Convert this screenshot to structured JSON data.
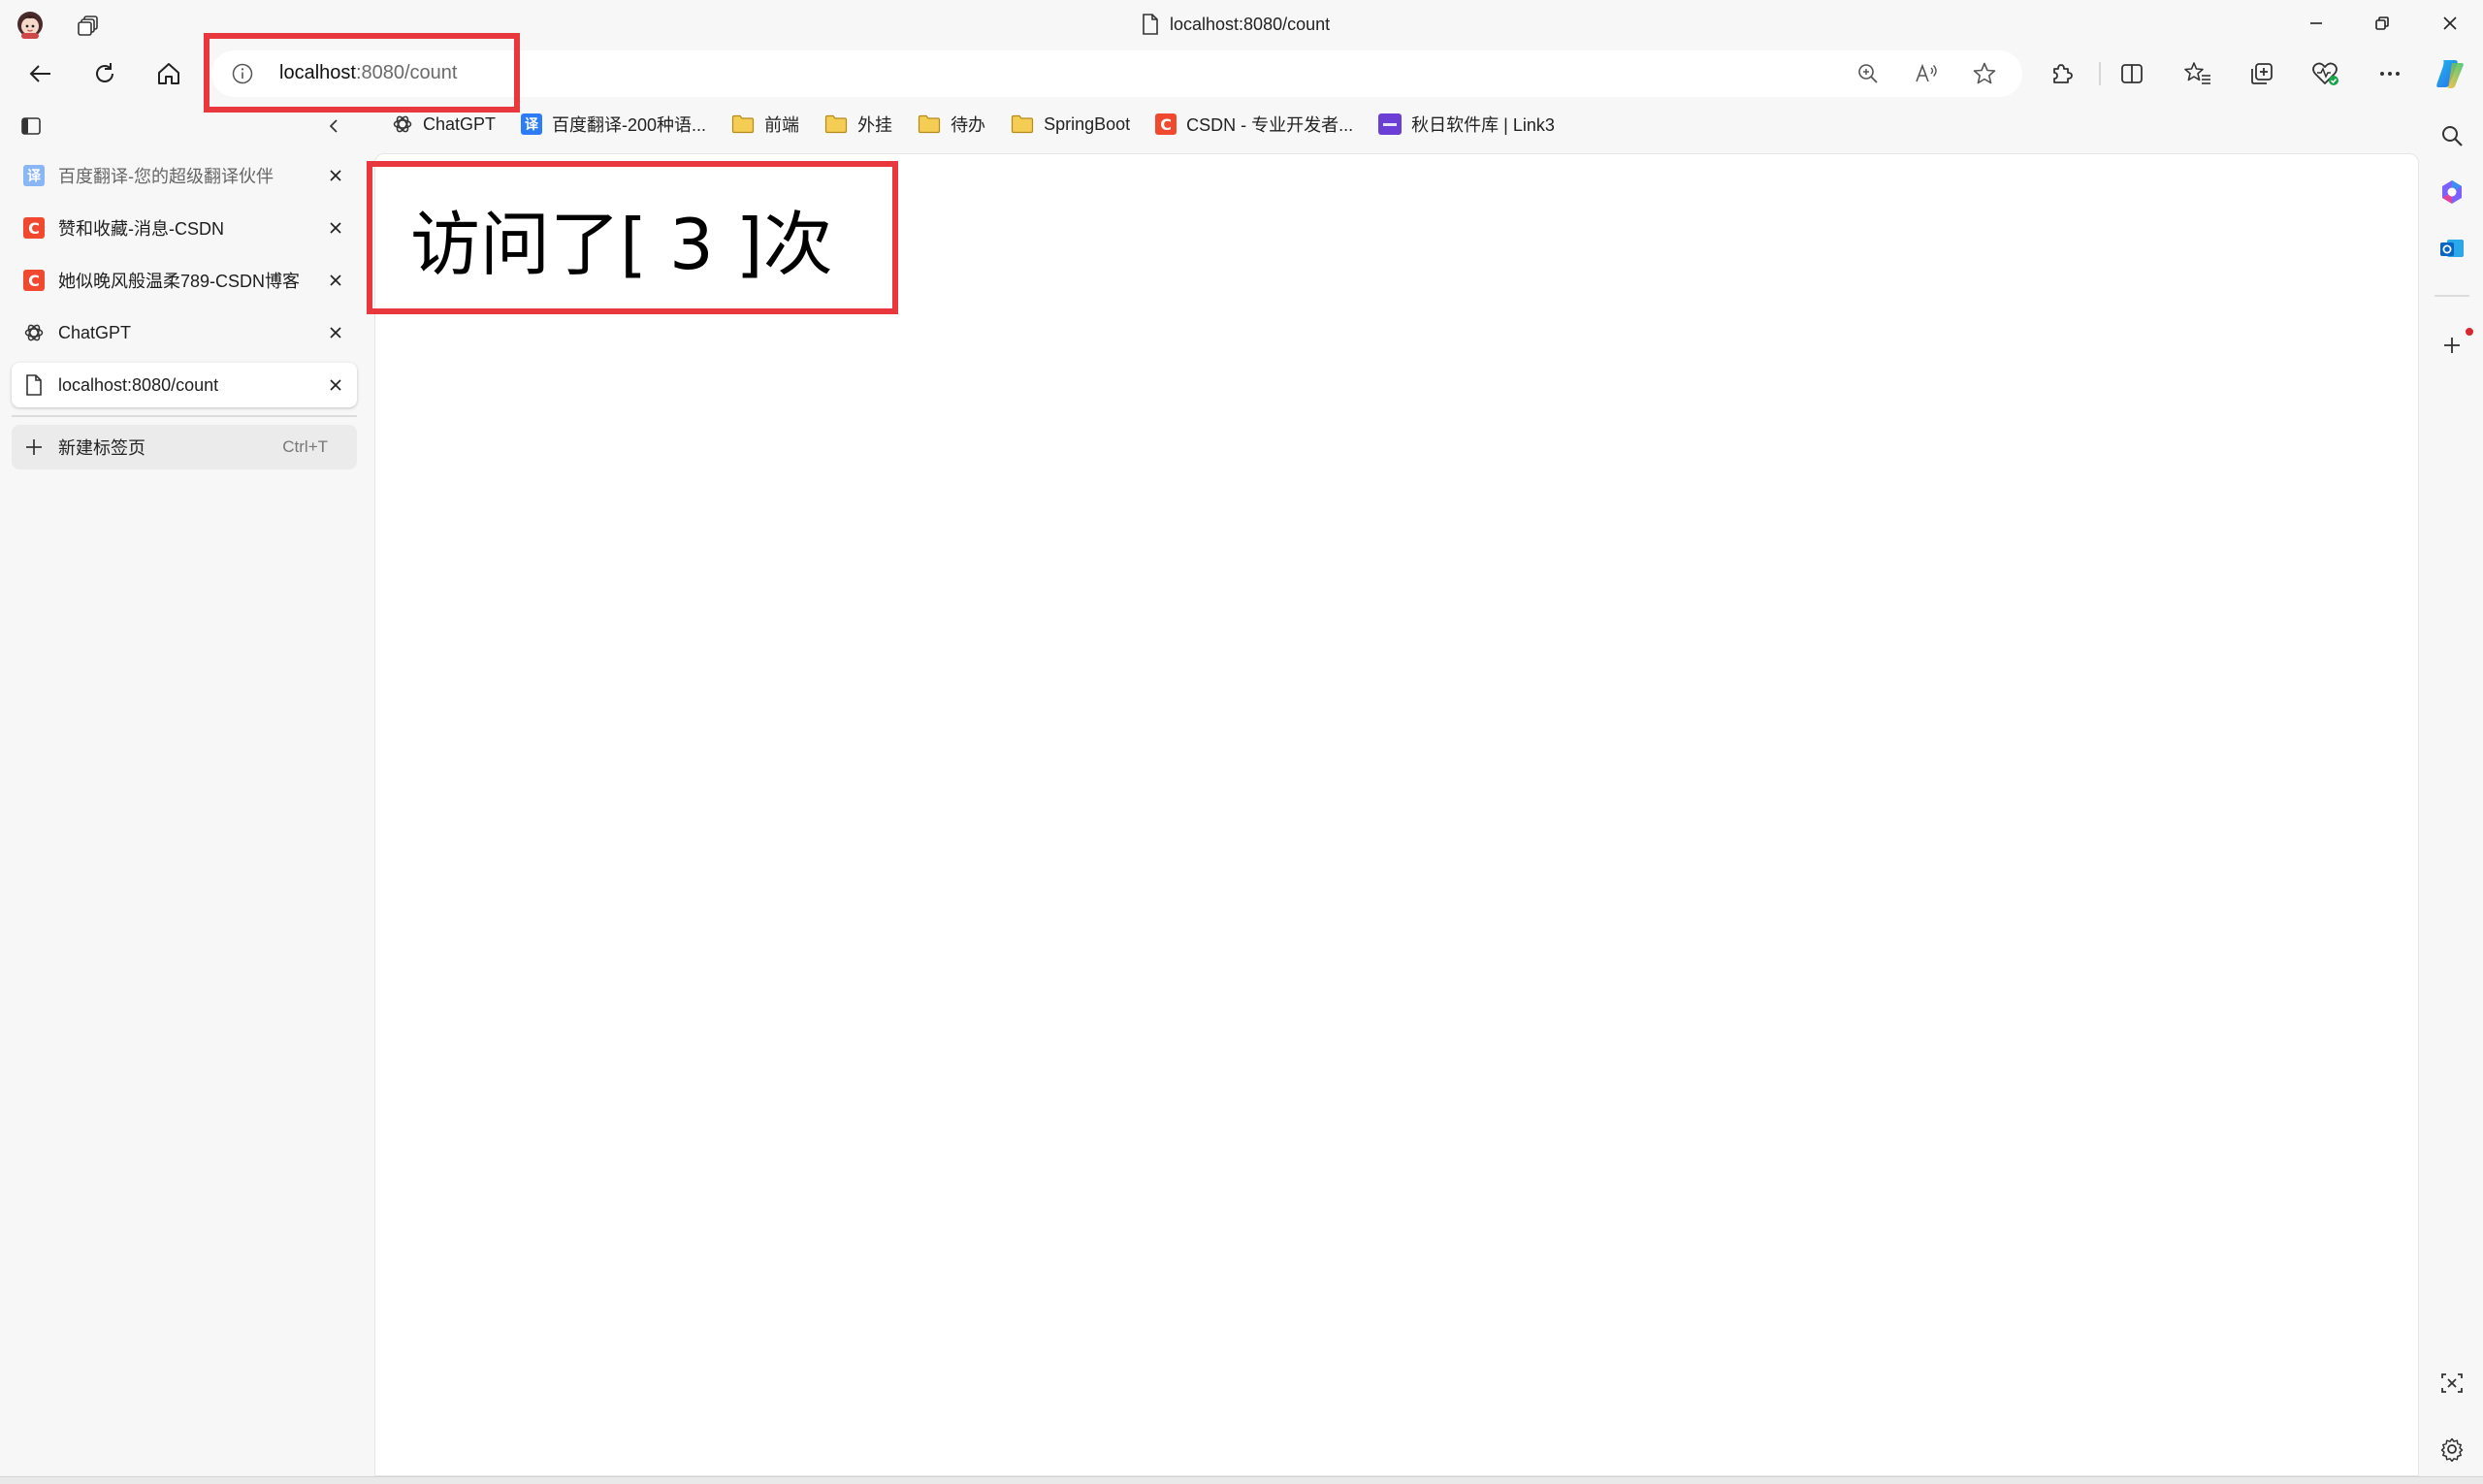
{
  "window": {
    "title": "localhost:8080/count",
    "controls": {
      "minimize": "minimize",
      "restore": "restore",
      "close": "close"
    }
  },
  "toolbar": {
    "url_host": "localhost",
    "url_rest": ":8080/count"
  },
  "favorites": [
    {
      "label": "ChatGPT",
      "icon": "chatgpt-icon"
    },
    {
      "label": "百度翻译-200种语...",
      "icon": "baidu-translate-icon"
    },
    {
      "label": "前端",
      "icon": "folder-icon"
    },
    {
      "label": "外挂",
      "icon": "folder-icon"
    },
    {
      "label": "待办",
      "icon": "folder-icon"
    },
    {
      "label": "SpringBoot",
      "icon": "folder-icon"
    },
    {
      "label": "CSDN - 专业开发者...",
      "icon": "csdn-icon"
    },
    {
      "label": "秋日软件库 | Link3",
      "icon": "link3-icon"
    }
  ],
  "tabs": [
    {
      "label": "百度翻译-您的超级翻译伙伴",
      "icon": "baidu-translate-icon",
      "active": false
    },
    {
      "label": "赞和收藏-消息-CSDN",
      "icon": "csdn-icon",
      "active": false
    },
    {
      "label": "她似晚风般温柔789-CSDN博客",
      "icon": "csdn-icon",
      "active": false
    },
    {
      "label": "ChatGPT",
      "icon": "chatgpt-icon",
      "active": false
    },
    {
      "label": "localhost:8080/count",
      "icon": "page-icon",
      "active": true
    }
  ],
  "new_tab": {
    "label": "新建标签页",
    "shortcut": "Ctrl+T"
  },
  "page": {
    "counter_text": "访问了[ 3 ]次"
  },
  "colors": {
    "highlight_border": "#e8383d",
    "csdn_brand": "#f1492f",
    "baidu_brand": "#2b7cf6",
    "link3_brand": "#6b3fd6"
  }
}
